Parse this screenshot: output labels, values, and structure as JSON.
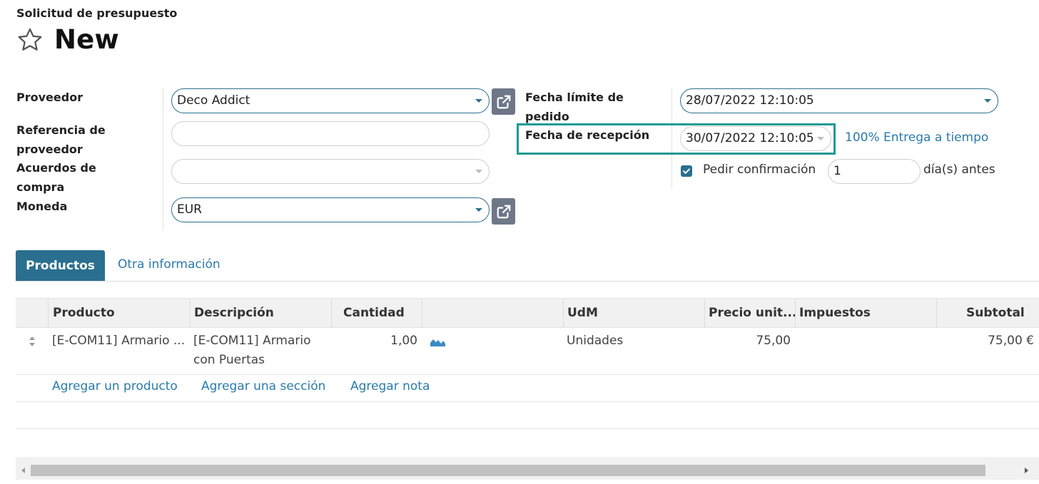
{
  "header": {
    "breadcrumb": "Solicitud de presupuesto",
    "title": "New"
  },
  "form": {
    "proveedor_label": "Proveedor",
    "proveedor_value": "Deco Addict",
    "ref_label_1": "Referencia de",
    "ref_label_2": "proveedor",
    "ref_value": "",
    "acuerdos_label_1": "Acuerdos de",
    "acuerdos_label_2": "compra",
    "acuerdos_value": "",
    "moneda_label": "Moneda",
    "moneda_value": "EUR",
    "fecha_limite_label_1": "Fecha límite de",
    "fecha_limite_label_2": "pedido",
    "fecha_limite_value": "28/07/2022 12:10:05",
    "fecha_recepcion_label": "Fecha de recepción",
    "fecha_recepcion_value": "30/07/2022 12:10:05",
    "on_time_link": "100% Entrega a tiempo",
    "pedir_confirmacion_label": "Pedir confirmación",
    "pedir_confirmacion_checked": true,
    "dias_value": "1",
    "dias_suffix": "día(s) antes"
  },
  "tabs": [
    {
      "label": "Productos",
      "active": true
    },
    {
      "label": "Otra información",
      "active": false
    }
  ],
  "table": {
    "columns": [
      "Producto",
      "Descripción",
      "Cantidad",
      "",
      "UdM",
      "Precio unit...",
      "Impuestos",
      "Subtotal"
    ],
    "rows": [
      {
        "producto": "[E-COM11] Armario ...",
        "descripcion_1": "[E-COM11] Armario",
        "descripcion_2": "con Puertas",
        "cantidad": "1,00",
        "udm": "Unidades",
        "precio": "75,00",
        "impuestos": "",
        "subtotal": "75,00 €"
      }
    ],
    "actions": [
      "Agregar un producto",
      "Agregar una sección",
      "Agregar nota"
    ]
  },
  "colors": {
    "primary": "#2a6f8f",
    "link": "#2a7bab",
    "highlight": "#1d9a93"
  }
}
